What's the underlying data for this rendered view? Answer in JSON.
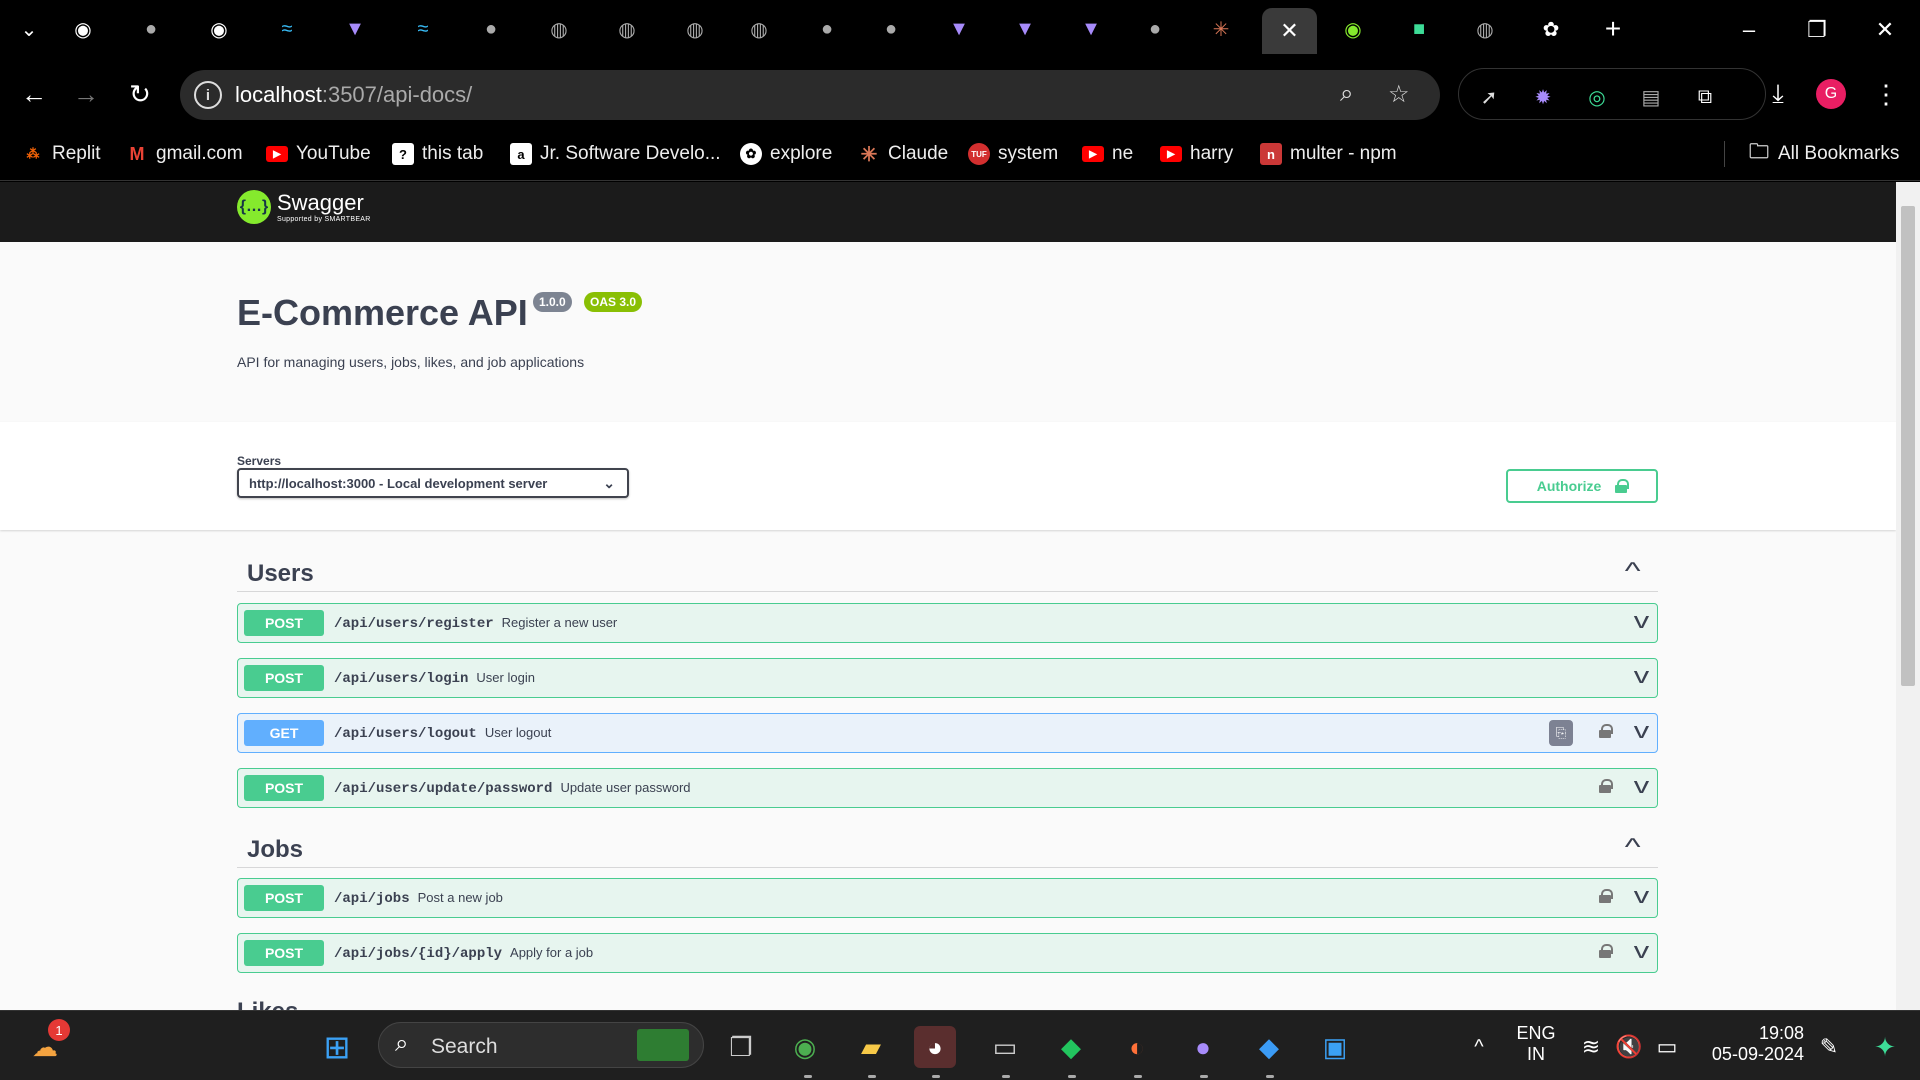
{
  "browser": {
    "active_tab_close": "✕",
    "new_tab": "+",
    "url_host": "localhost",
    "url_rest": ":3507/api-docs/",
    "profile_initial": "G"
  },
  "bookmarks": [
    {
      "label": "Replit",
      "icon": "replit-icon",
      "color": "#f26207"
    },
    {
      "label": "gmail.com",
      "icon": "gmail-icon",
      "color": "#ea4335"
    },
    {
      "label": "YouTube",
      "icon": "youtube-icon",
      "color": "#ff0000"
    },
    {
      "label": "this tab",
      "icon": "question-icon",
      "color": "#ffffff"
    },
    {
      "label": "Jr. Software Develo...",
      "icon": "amazon-icon",
      "color": "#ffffff"
    },
    {
      "label": "explore",
      "icon": "openai-icon",
      "color": "#ffffff"
    },
    {
      "label": "Claude",
      "icon": "claude-icon",
      "color": "#d97757"
    },
    {
      "label": "system",
      "icon": "tuf-icon",
      "color": "#d32f2f"
    },
    {
      "label": "ne",
      "icon": "youtube-icon",
      "color": "#ff0000"
    },
    {
      "label": "harry",
      "icon": "youtube-icon",
      "color": "#ff0000"
    },
    {
      "label": "multer - npm",
      "icon": "npm-icon",
      "color": "#cb3837"
    }
  ],
  "all_bookmarks": "All Bookmarks",
  "swagger": {
    "logo_text": "Swagger",
    "logo_sub": "Supported by SMARTBEAR",
    "title": "E-Commerce API",
    "version": "1.0.0",
    "oas": "OAS 3.0",
    "description": "API for managing users, jobs, likes, and job applications",
    "servers_label": "Servers",
    "server_selected": "http://localhost:3000 - Local development server",
    "authorize_label": "Authorize"
  },
  "sections": [
    {
      "name": "Users",
      "ops": [
        {
          "method": "POST",
          "path": "/api/users/register",
          "summary": "Register a new user",
          "locked": false
        },
        {
          "method": "POST",
          "path": "/api/users/login",
          "summary": "User login",
          "locked": false
        },
        {
          "method": "GET",
          "path": "/api/users/logout",
          "summary": "User logout",
          "locked": true
        },
        {
          "method": "POST",
          "path": "/api/users/update/password",
          "summary": "Update user password",
          "locked": true
        }
      ]
    },
    {
      "name": "Jobs",
      "ops": [
        {
          "method": "POST",
          "path": "/api/jobs",
          "summary": "Post a new job",
          "locked": true
        },
        {
          "method": "POST",
          "path": "/api/jobs/{id}/apply",
          "summary": "Apply for a job",
          "locked": true
        }
      ]
    }
  ],
  "partial_section": "Likes",
  "taskbar": {
    "search_placeholder": "Search",
    "weather_badge": "1",
    "lang_top": "ENG",
    "lang_bottom": "IN",
    "time": "19:08",
    "date": "05-09-2024"
  },
  "colors": {
    "post": "#49cc90",
    "get": "#61affe",
    "swagger_green": "#85ea2d"
  }
}
